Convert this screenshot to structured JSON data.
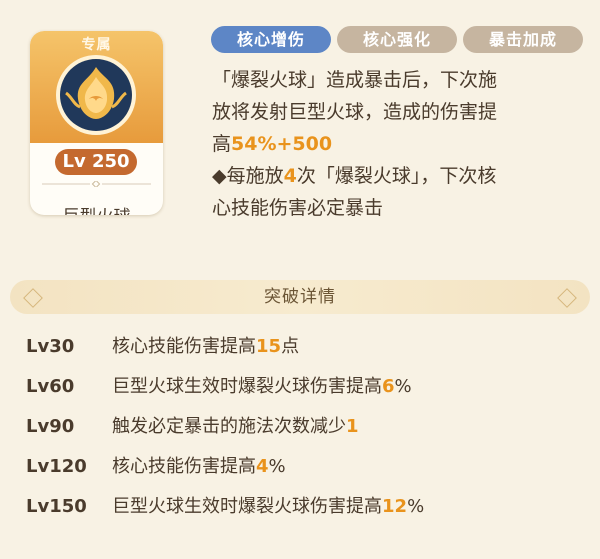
{
  "card": {
    "tag": "专属",
    "level": "Lv 250",
    "name": "巨型火球",
    "icon": "fireball-icon"
  },
  "tabs": [
    {
      "label": "核心增伤",
      "active": true
    },
    {
      "label": "核心强化",
      "active": false
    },
    {
      "label": "暴击加成",
      "active": false
    }
  ],
  "description": {
    "line1": "「爆裂火球」造成暴击后，下次施",
    "line2": "放将发射巨型火球，造成的伤害提",
    "line3_prefix": "高",
    "line3_value1": "54%",
    "line3_value2": "+500",
    "line4_prefix": "◆每施放",
    "line4_value": "4",
    "line4_suffix": "次「爆裂火球」，下次核",
    "line5": "心技能伤害必定暴击"
  },
  "breakthrough": {
    "title": "突破详情",
    "rows": [
      {
        "level": "Lv30",
        "text": "核心技能伤害提高",
        "value": "15",
        "unit": "点"
      },
      {
        "level": "Lv60",
        "text": "巨型火球生效时爆裂火球伤害提高",
        "value": "6",
        "unit": "%"
      },
      {
        "level": "Lv90",
        "text": "触发必定暴击的施法次数减少",
        "value": "1",
        "unit": ""
      },
      {
        "level": "Lv120",
        "text": "核心技能伤害提高",
        "value": "4",
        "unit": "%"
      },
      {
        "level": "Lv150",
        "text": "巨型火球生效时爆裂火球伤害提高",
        "value": "12",
        "unit": "%"
      }
    ]
  },
  "colors": {
    "accent": "#e9931c",
    "tab_active": "#5d86c6",
    "tab_inactive": "#c6b5a0",
    "badge": "#c4692f"
  }
}
